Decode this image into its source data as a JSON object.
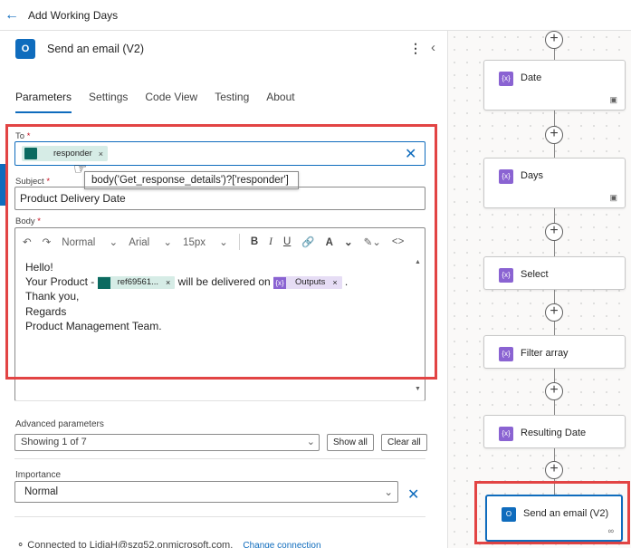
{
  "topbar": {
    "title": "Add Working Days"
  },
  "panel": {
    "action_name": "Send an email (V2)",
    "tabs": [
      "Parameters",
      "Settings",
      "Code View",
      "Testing",
      "About"
    ],
    "to_label": "To",
    "to_chip": "responder",
    "tooltip": "body('Get_response_details')?['responder']",
    "subject_label": "Subject",
    "subject_value": "Product Delivery Date",
    "body_label": "Body",
    "toolbar": {
      "font": "Normal",
      "family": "Arial",
      "size": "15px",
      "bold": "B",
      "italic": "I",
      "underline": "U",
      "font_color": "A"
    },
    "body_lines": [
      "Hello!",
      "Your Product -",
      "will be delivered on",
      "Thank you,",
      "Regards",
      "Product Management Team."
    ],
    "body_chip_ref": "ref69561...",
    "body_chip_outputs": "Outputs",
    "adv_label": "Advanced parameters",
    "adv_value": "Showing 1 of 7",
    "show_all": "Show all",
    "clear_all": "Clear all",
    "importance_label": "Importance",
    "importance_value": "Normal",
    "connected_text": "Connected to LidiaH@szg52.onmicrosoft.com.",
    "change_connection": "Change connection"
  },
  "canvas": {
    "cards": [
      "Date",
      "Days",
      "Select",
      "Filter array",
      "Resulting Date",
      "Send an email (V2)"
    ]
  },
  "colors": {
    "accent": "#0f6cbd",
    "highlight": "#e24444",
    "chip_green": "#0b6a60",
    "chip_purple": "#8a63d2"
  }
}
